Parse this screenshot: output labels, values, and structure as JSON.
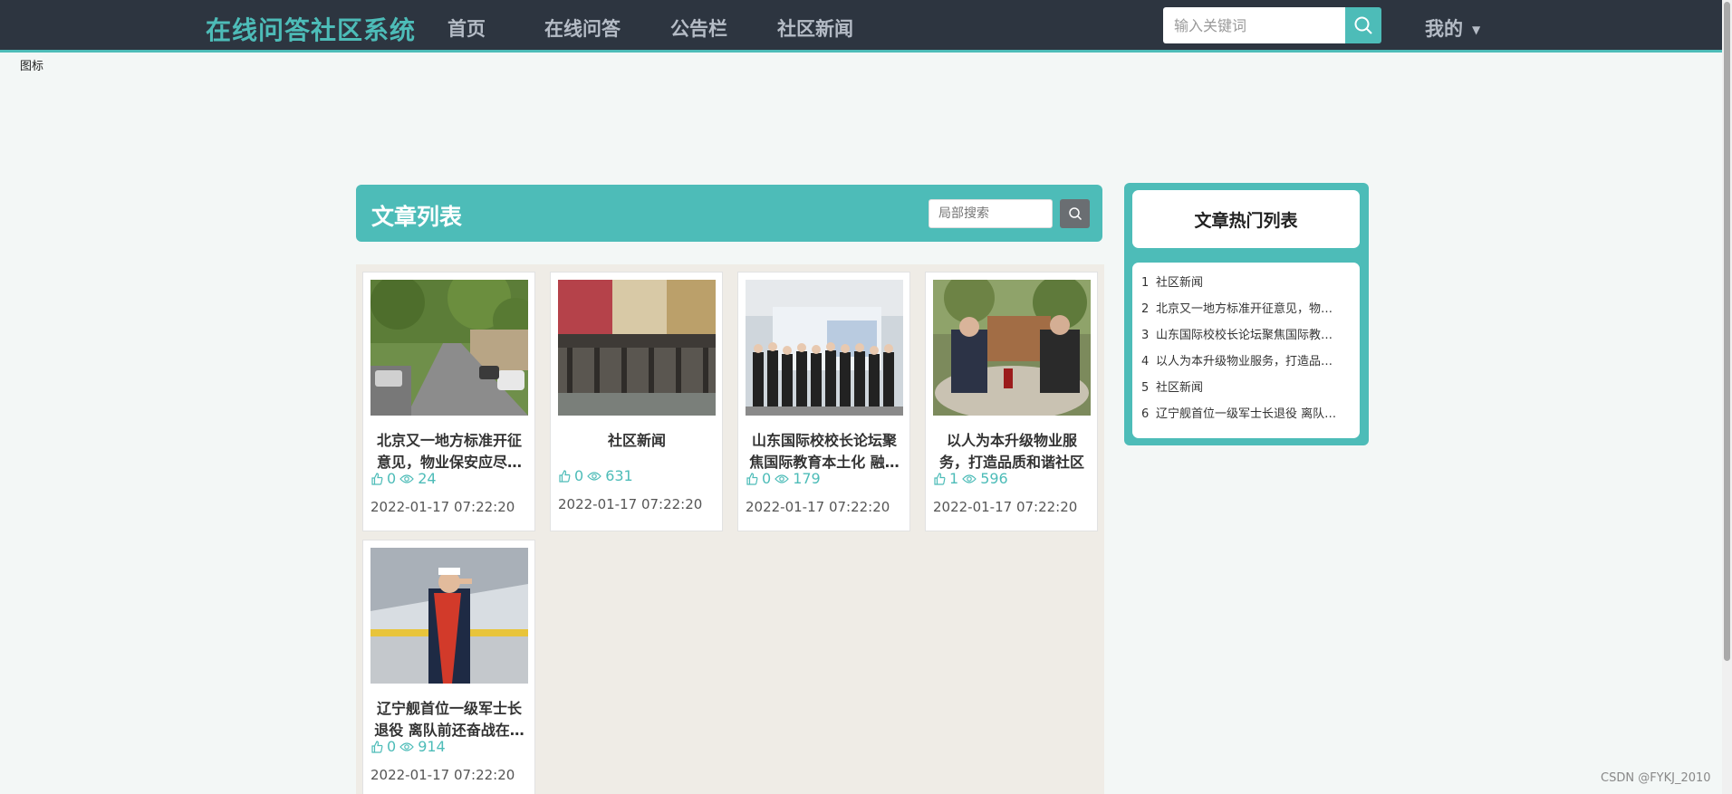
{
  "nav": {
    "brand": "在线问答社区系统",
    "items": [
      "首页",
      "在线问答",
      "公告栏",
      "社区新闻"
    ],
    "search_placeholder": "输入关键词",
    "mine_label": "我的"
  },
  "broken_image_text": "图标",
  "article_list": {
    "title": "文章列表",
    "local_search_placeholder": "局部搜索",
    "cards": [
      {
        "title": "北京又一地方标准开征意见，物业保安应尽…",
        "likes": "0",
        "views": "24",
        "date": "2022-01-17 07:22:20"
      },
      {
        "title": "社区新闻",
        "likes": "0",
        "views": "631",
        "date": "2022-01-17 07:22:20"
      },
      {
        "title": "山东国际校校长论坛聚焦国际教育本土化 融…",
        "likes": "0",
        "views": "179",
        "date": "2022-01-17 07:22:20"
      },
      {
        "title": "以人为本升级物业服务，打造品质和谐社区",
        "likes": "1",
        "views": "596",
        "date": "2022-01-17 07:22:20"
      },
      {
        "title": "辽宁舰首位一级军士长退役 离队前还奋战在…",
        "likes": "0",
        "views": "914",
        "date": "2022-01-17 07:22:20"
      }
    ]
  },
  "hot_list": {
    "title": "文章热门列表",
    "items": [
      {
        "num": "1",
        "label": "社区新闻"
      },
      {
        "num": "2",
        "label": "北京又一地方标准开征意见，物…"
      },
      {
        "num": "3",
        "label": "山东国际校校长论坛聚焦国际教…"
      },
      {
        "num": "4",
        "label": "以人为本升级物业服务，打造品…"
      },
      {
        "num": "5",
        "label": "社区新闻"
      },
      {
        "num": "6",
        "label": "辽宁舰首位一级军士长退役 离队…"
      }
    ]
  },
  "watermark": "CSDN @FYKJ_2010",
  "colors": {
    "accent": "#4dbcb8",
    "nav_bg": "#2d3540",
    "panel_bg": "#efece6"
  },
  "icons": {
    "search": "search-icon",
    "like": "thumb-up-icon",
    "view": "eye-icon",
    "caret": "caret-down-icon"
  }
}
